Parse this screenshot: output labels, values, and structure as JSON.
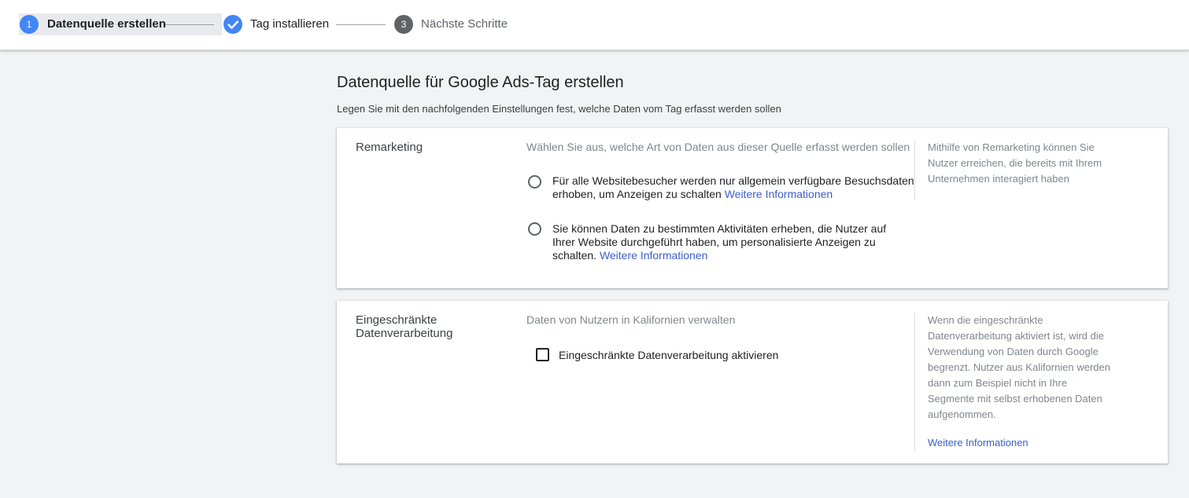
{
  "stepper": {
    "steps": [
      {
        "number": "1",
        "label": "Datenquelle erstellen",
        "state": "active"
      },
      {
        "number": "",
        "label": "Tag installieren",
        "state": "completed"
      },
      {
        "number": "3",
        "label": "Nächste Schritte",
        "state": "inactive"
      }
    ]
  },
  "main": {
    "title": "Datenquelle für Google Ads-Tag erstellen",
    "subtitle": "Legen Sie mit den nachfolgenden Einstellungen fest, welche Daten vom Tag erfasst werden sollen"
  },
  "remarketing": {
    "title": "Remarketing",
    "description": "Wählen Sie aus, welche Art von Daten aus dieser Quelle erfasst werden sollen",
    "options": [
      {
        "text": "Für alle Websitebesucher werden nur allgemein verfügbare Besuchsdaten erhoben, um Anzeigen zu schalten",
        "link": "Weitere Informationen",
        "selected": false
      },
      {
        "text": "Sie können Daten zu bestimmten Aktivitäten erheben, die Nutzer auf Ihrer Website durchgeführt haben, um personalisierte Anzeigen zu schalten.",
        "link": "Weitere Informationen",
        "selected": false
      }
    ],
    "help": "Mithilfe von Remarketing können Sie Nutzer erreichen, die bereits mit Ihrem Unternehmen interagiert haben"
  },
  "restricted": {
    "title": "Eingeschränkte Datenverarbeitung",
    "description": "Daten von Nutzern in Kalifornien verwalten",
    "checkbox_label": "Eingeschränkte Datenverarbeitung aktivieren",
    "checked": false,
    "help": "Wenn die eingeschränkte Datenverarbeitung aktiviert ist, wird die Verwendung von Daten durch Google begrenzt. Nutzer aus Kalifornien werden dann zum Beispiel nicht in Ihre Segmente mit selbst erhobenen Daten aufgenommen.",
    "help_link": "Weitere Informationen"
  },
  "colors": {
    "accent": "#4285f4",
    "link": "#3b5fc9",
    "inactive_step": "#5f6368"
  }
}
